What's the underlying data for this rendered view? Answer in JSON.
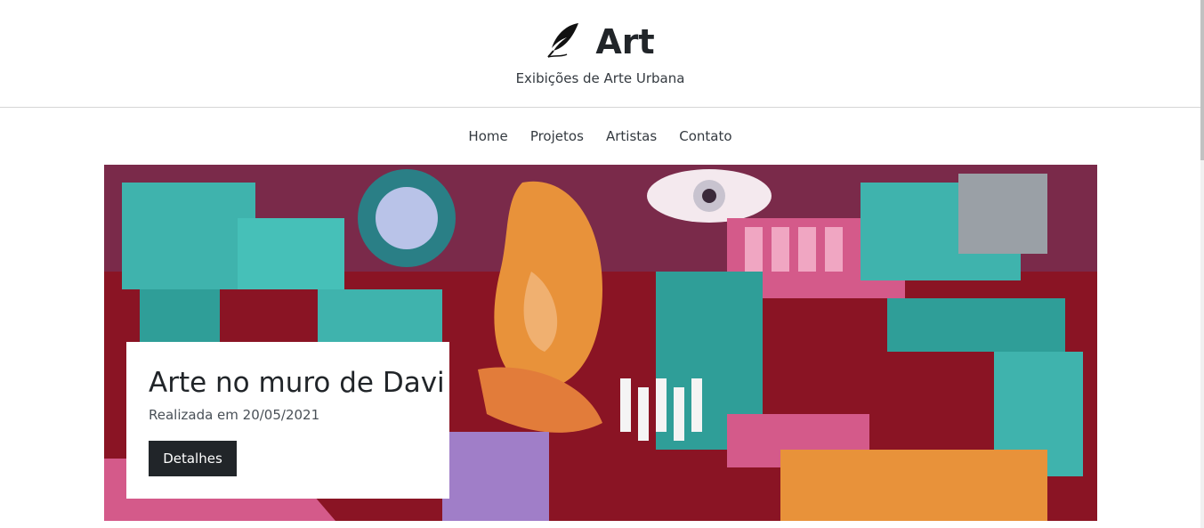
{
  "brand": {
    "icon": "feather-quill-icon",
    "title": "Art",
    "subtitle": "Exibições de Arte Urbana"
  },
  "nav": {
    "items": [
      "Home",
      "Projetos",
      "Artistas",
      "Contato"
    ]
  },
  "hero": {
    "image_desc_icon": "graffiti-artwork-image",
    "card": {
      "title": "Arte no muro de Davi",
      "date": "Realizada em 20/05/2021",
      "button_label": "Detalhes"
    }
  },
  "colors": {
    "dark": "#212529",
    "teal": "#3fb3ad",
    "crimson": "#8a1424",
    "pink": "#d45a8a",
    "orange": "#e8923a"
  }
}
